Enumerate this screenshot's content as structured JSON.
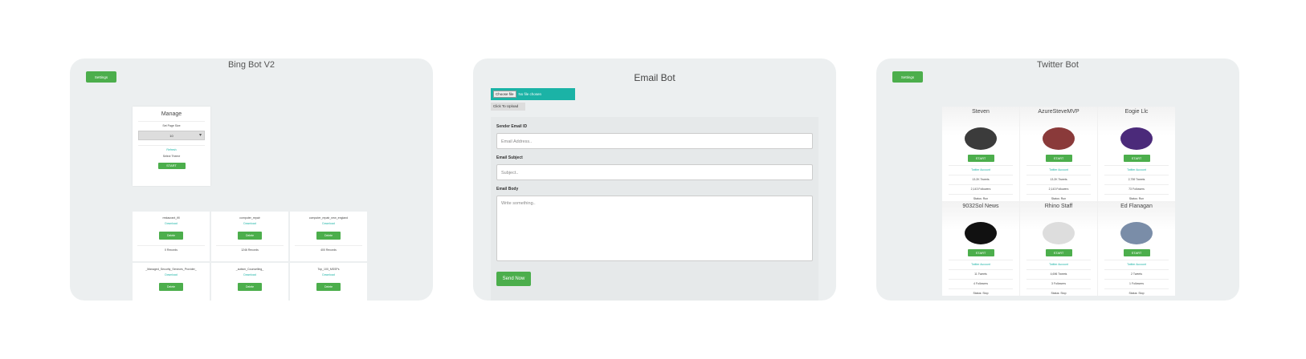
{
  "bing": {
    "title": "Bing Bot V2",
    "settings_label": "Settings",
    "manage": {
      "title": "Manage",
      "set_page_size_label": "Set Page Size",
      "page_size_value": "10",
      "refresh_label": "Refresh",
      "select_theme_label": "Select Theme",
      "start_label": "START"
    },
    "files": [
      {
        "name": "restaurant_ifll",
        "download": "Download",
        "delete": "Delete",
        "records": "0 Records"
      },
      {
        "name": "computer_repair",
        "download": "Download",
        "delete": "Delete",
        "records": "1246 Records"
      },
      {
        "name": "computer_repair_new_england",
        "download": "Download",
        "delete": "Delete",
        "records": "400 Records"
      },
      {
        "name": "_Managed_Security_Services_Provider_",
        "download": "Download",
        "delete": "Delete",
        "records": ""
      },
      {
        "name": "_autism_Counselling_",
        "download": "Download",
        "delete": "Delete",
        "records": ""
      },
      {
        "name": "Top_100_MSSPs",
        "download": "Download",
        "delete": "Delete",
        "records": ""
      }
    ]
  },
  "email": {
    "title": "Email Bot",
    "choose_file_label": "Choose file",
    "no_file_text": "No file chosen",
    "upload_label": "Click To Upload",
    "sender_label": "Sender Email ID",
    "sender_placeholder": "Email Address..",
    "subject_label": "Email Subject",
    "subject_placeholder": "Subject..",
    "body_label": "Email Body",
    "body_placeholder": "Write something..",
    "send_label": "Send Now"
  },
  "twitter": {
    "title": "Twitter Bot",
    "settings_label": "Settings",
    "accounts": [
      {
        "name": "Steven",
        "start": "START",
        "link": "Twitter Account",
        "tweets": "13.2K Tweets",
        "followers": "2,143 Followers",
        "status": "Status: Run",
        "avatar_color": "#3b3b3b"
      },
      {
        "name": "AzureSteveMVP",
        "start": "START",
        "link": "Twitter Account",
        "tweets": "13.2K Tweets",
        "followers": "2,143 Followers",
        "status": "Status: Run",
        "avatar_color": "#8a3a3a"
      },
      {
        "name": "Eogie Llc",
        "start": "START",
        "link": "Twitter Account",
        "tweets": "2,759 Tweets",
        "followers": "73 Followers",
        "status": "Status: Run",
        "avatar_color": "#4b2a7a"
      },
      {
        "name": "9032Sol News",
        "start": "START",
        "link": "Twitter Account",
        "tweets": "11 Tweets",
        "followers": "4 Followers",
        "status": "Status: Stop",
        "avatar_color": "#111111"
      },
      {
        "name": "Rhino Staff",
        "start": "START",
        "link": "Twitter Account",
        "tweets": "4,696 Tweets",
        "followers": "3 Followers",
        "status": "Status: Stop",
        "avatar_color": "#dddddd"
      },
      {
        "name": "Ed Flanagan",
        "start": "START",
        "link": "Twitter Account",
        "tweets": "2 Tweets",
        "followers": "1 Followers",
        "status": "Status: Stop",
        "avatar_color": "#7a8da8"
      }
    ]
  },
  "colors": {
    "accent_green": "#4cae4c",
    "accent_teal": "#1bb3a6",
    "panel_bg": "#eceff0"
  }
}
